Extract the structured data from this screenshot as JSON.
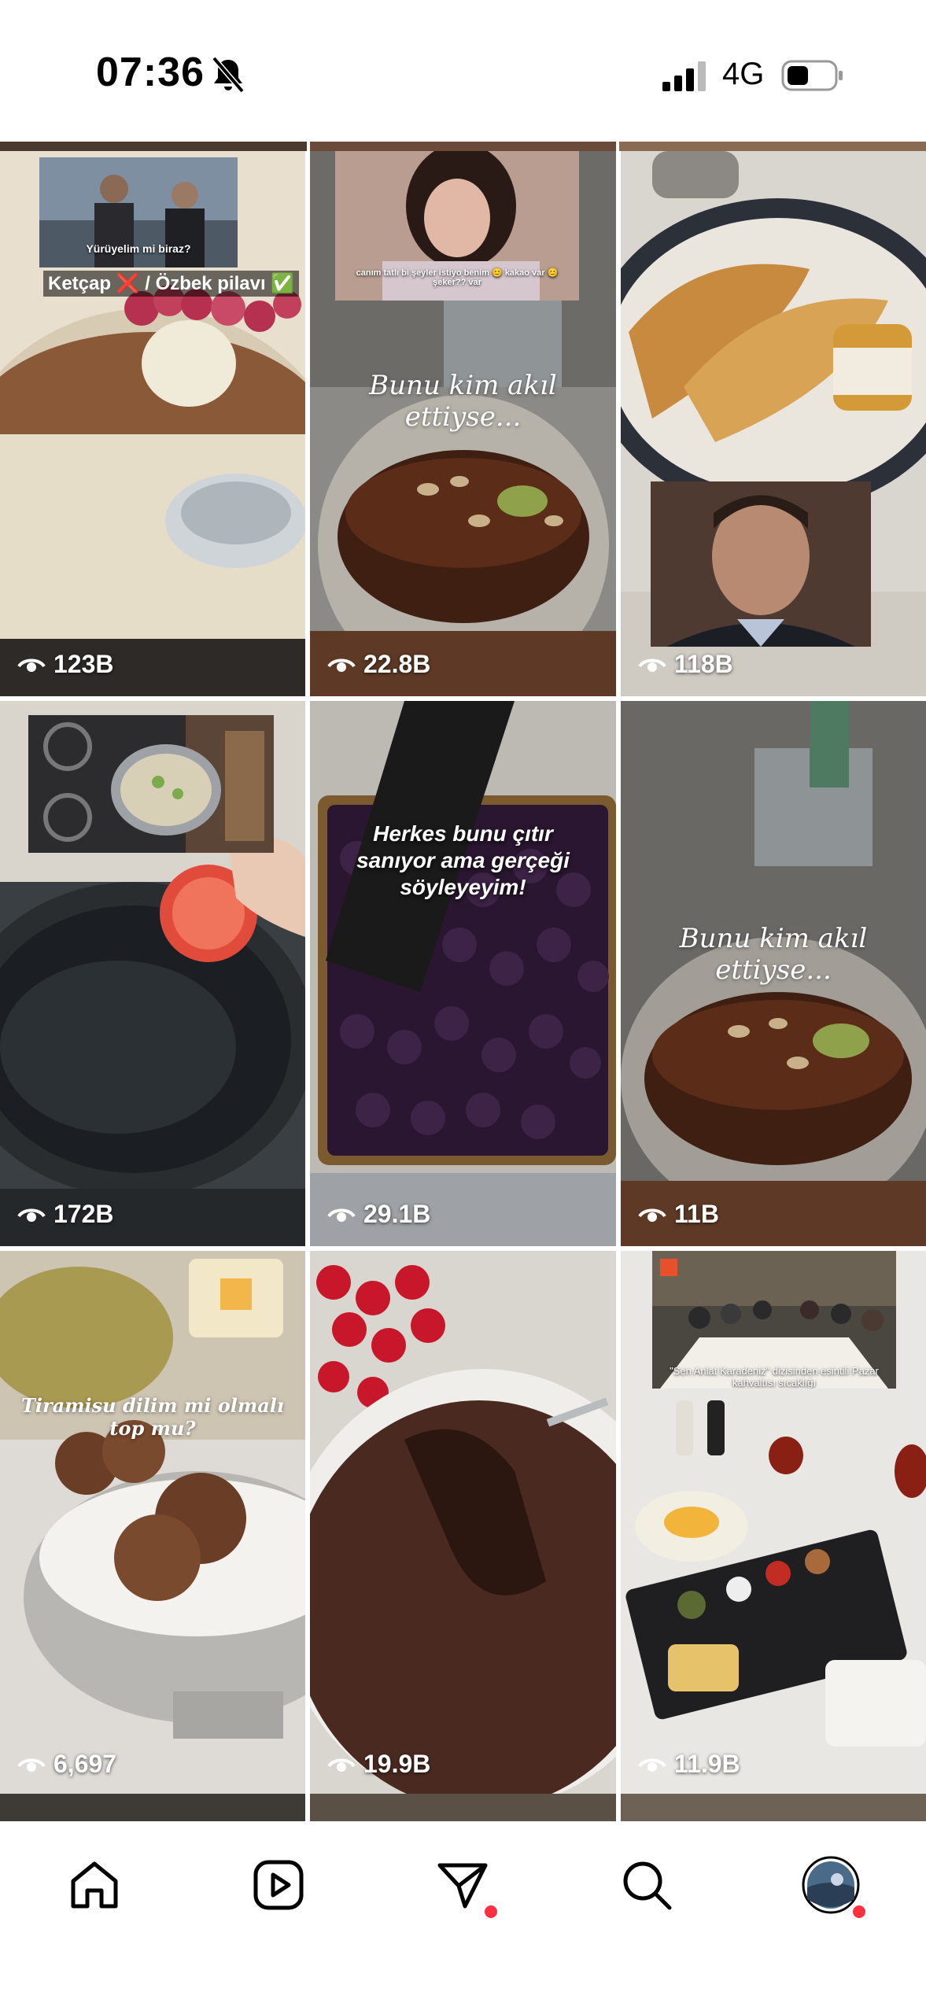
{
  "status_bar": {
    "time": "07:36",
    "network": "4G",
    "icons": [
      "bell-slash-icon",
      "signal-bars-icon",
      "battery-icon"
    ]
  },
  "grid": {
    "tiles": [
      {
        "views": "123B",
        "caption_inset": "Yürüyelim mi biraz?",
        "caption_main": "Ketçap ❌ / Özbek pilavı ✅"
      },
      {
        "views": "22.8B",
        "caption_inset": "canım tatlı bi şeyler istiyo benim 😊 kakao var 😊 şeker?? var",
        "caption_main": "Bunu kim akıl ettiyse..."
      },
      {
        "views": "118B"
      },
      {
        "views": "172B"
      },
      {
        "views": "29.1B",
        "caption_main": "Herkes bunu çıtır sanıyor ama gerçeği söyleyeyim!"
      },
      {
        "views": "11B",
        "caption_main": "Bunu kim akıl ettiyse..."
      },
      {
        "views": "6,697",
        "caption_main": "Tiramisu dilim mi olmalı top mu?"
      },
      {
        "views": "19.9B"
      },
      {
        "views": "11.9B",
        "caption_inset": "\"Sen Anlat Karadeniz\" dizisinden esintili Pazar kahvaltısı sıcaklığı"
      }
    ]
  },
  "tab_bar": {
    "tabs": [
      "home-icon",
      "reels-icon",
      "direct-messages-icon",
      "search-icon",
      "profile-avatar"
    ],
    "notification_color": "#ff3040"
  }
}
